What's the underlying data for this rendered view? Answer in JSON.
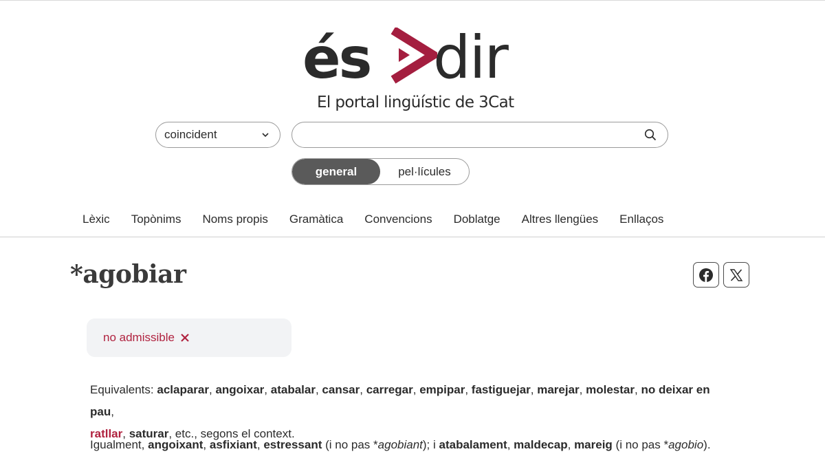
{
  "logo": {
    "left_text": "és",
    "right_text": "dir",
    "brand_color": "#a41e3f"
  },
  "tagline": "El portal lingüístic de 3Cat",
  "search": {
    "mode_select": {
      "selected": "coincident"
    },
    "input": {
      "value": "",
      "placeholder": ""
    }
  },
  "toggle": {
    "options": [
      "general",
      "pel·lícules"
    ],
    "active": "general"
  },
  "nav": {
    "items": [
      "Lèxic",
      "Topònims",
      "Noms propis",
      "Gramàtica",
      "Convencions",
      "Doblatge",
      "Altres llengües",
      "Enllaços"
    ]
  },
  "entry": {
    "title": "*agobiar",
    "status": "no admissible",
    "equivalents_label": "Equivalents:",
    "equivalents": [
      "aclaparar",
      "angoixar",
      "atabalar",
      "cansar",
      "carregar",
      "empipar",
      "fastiguejar",
      "marejar",
      "molestar",
      "no deixar en pau",
      "ratllar",
      "saturar"
    ],
    "equivalents_tail": ", etc., segons el context.",
    "also_label": "Igualment,",
    "also_words_1": [
      "angoixant",
      "asfixiant",
      "estressant"
    ],
    "also_not_1_pre": "(i no pas *",
    "also_not_1_word": "agobiant",
    "also_not_1_post": "); i",
    "also_words_2": [
      "atabalament",
      "maldecap",
      "mareig"
    ],
    "also_not_2_pre": "(i no pas *",
    "also_not_2_word": "agobio",
    "also_not_2_post": ")."
  },
  "share": {
    "facebook_icon": "facebook-icon",
    "x_icon": "x-icon"
  },
  "colors": {
    "text": "#2b2b2b",
    "accent": "#b0223f",
    "toggle_active_bg": "#5a5a5a",
    "status_bg": "#f2f3f5"
  }
}
